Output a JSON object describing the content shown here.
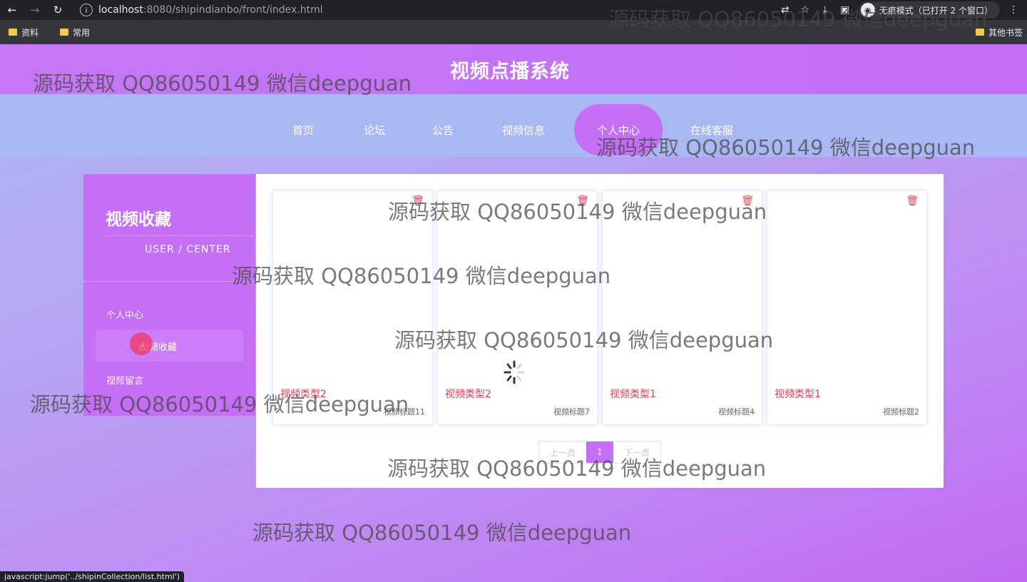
{
  "browser": {
    "url_host": "localhost",
    "url_path": ":8080/shipindianbo/front/index.html",
    "incognito_label": "无痕模式（已打开 2 个窗口）",
    "bookmarks": [
      "资料",
      "常用"
    ],
    "other_bookmarks": "其他书签",
    "status_text": "javascript:jump('../shipinCollection/list.html')"
  },
  "site": {
    "title": "视频点播系统"
  },
  "nav": {
    "items": [
      {
        "label": "首页"
      },
      {
        "label": "论坛"
      },
      {
        "label": "公告"
      },
      {
        "label": "视频信息"
      },
      {
        "label": "个人中心",
        "active": true
      },
      {
        "label": "在线客服"
      }
    ]
  },
  "sidebar": {
    "title": "视频收藏",
    "subtitle": "USER / CENTER",
    "items": [
      {
        "label": "个人中心"
      },
      {
        "label": "视频收藏",
        "active": true
      },
      {
        "label": "视频留言"
      }
    ]
  },
  "cards": [
    {
      "type": "视频类型2",
      "title": "视频标题11"
    },
    {
      "type": "视频类型2",
      "title": "视频标题7"
    },
    {
      "type": "视频类型1",
      "title": "视频标题4"
    },
    {
      "type": "视频类型1",
      "title": "视频标题2"
    }
  ],
  "pagination": {
    "prev": "上一页",
    "current": "1",
    "next": "下一页"
  },
  "watermark": "源码获取 QQ86050149 微信deepguan",
  "colors": {
    "accent": "#c46ff6",
    "type_text": "#e04050",
    "trash": "#e6485a"
  }
}
